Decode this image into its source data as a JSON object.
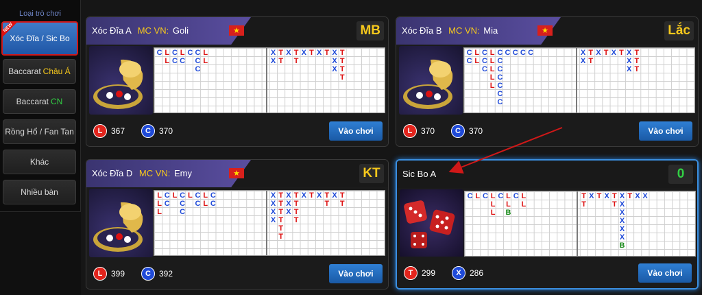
{
  "sidebar": {
    "title": "Loại trò chơi",
    "items": [
      {
        "label": "Xóc Đĩa / Sic Bo",
        "suffix": "",
        "active": true,
        "new_tag": "NEW"
      },
      {
        "label": "Baccarat",
        "suffix": "Châu Á",
        "suffix_color": "yellow"
      },
      {
        "label": "Baccarat",
        "suffix": "CN",
        "suffix_color": "green"
      },
      {
        "label": "Rồng Hổ / Fan Tan",
        "suffix": ""
      },
      {
        "label": "Khác",
        "suffix": ""
      },
      {
        "label": "Nhiều bàn",
        "suffix": ""
      }
    ]
  },
  "tables": [
    {
      "name": "Xóc Đĩa A",
      "mc_label": "MC VN:",
      "mc_name": "Goli",
      "badge": "MB",
      "stat1": {
        "icon": "L",
        "value": "367"
      },
      "stat2": {
        "icon": "C",
        "value": "370"
      },
      "button": "Vào chơi"
    },
    {
      "name": "Xóc Đĩa B",
      "mc_label": "MC VN:",
      "mc_name": "Mia",
      "badge": "Lắc",
      "stat1": {
        "icon": "L",
        "value": "370"
      },
      "stat2": {
        "icon": "C",
        "value": "370"
      },
      "button": "Vào chơi"
    },
    {
      "name": "Xóc Đĩa D",
      "mc_label": "MC VN:",
      "mc_name": "Emy",
      "badge": "KT",
      "stat1": {
        "icon": "L",
        "value": "399"
      },
      "stat2": {
        "icon": "C",
        "value": "392"
      },
      "button": "Vào chơi"
    },
    {
      "name": "Sic Bo A",
      "badge": "0",
      "stat1": {
        "icon": "T",
        "value": "299"
      },
      "stat2": {
        "icon": "X",
        "value": "286"
      },
      "button": "Vào chơi"
    }
  ],
  "colors": {
    "accent_blue": "#1f5aa6",
    "badge_yellow": "#f6c81c",
    "badge_green": "#32d044",
    "red_dot": "#e2241c",
    "blue_dot": "#1f4ad8",
    "road_red": "#d11",
    "road_blue": "#1f4ad8",
    "road_green": "#1a8a1a"
  },
  "roads": [
    {
      "left": [
        [
          "C"
        ],
        [
          "L",
          "L"
        ],
        [
          "C",
          "C"
        ],
        [
          "L",
          "C"
        ],
        [
          "C"
        ],
        [
          "C",
          "C",
          "C"
        ],
        [
          "L",
          "L"
        ]
      ],
      "right": [
        [
          "X",
          "X"
        ],
        [
          "T",
          "T"
        ],
        [
          "X"
        ],
        [
          "T",
          "T"
        ],
        [
          "X"
        ],
        [
          "T"
        ],
        [
          "X"
        ],
        [
          "T"
        ],
        [
          "X",
          "X",
          "X"
        ],
        [
          "T",
          "T",
          "T",
          "T"
        ]
      ]
    },
    {
      "left": [
        [
          "C",
          "C"
        ],
        [
          "L",
          "L"
        ],
        [
          "C",
          "C",
          "C"
        ],
        [
          "L",
          "L",
          "L",
          "L",
          "L"
        ],
        [
          "C",
          "C",
          "C",
          "C",
          "C",
          "C",
          "C"
        ],
        [
          "C"
        ],
        [
          "C"
        ],
        [
          "C"
        ],
        [
          "C"
        ]
      ],
      "right": [
        [
          "X",
          "X"
        ],
        [
          "T",
          "T"
        ],
        [
          "X"
        ],
        [
          "T"
        ],
        [
          "X"
        ],
        [
          "T"
        ],
        [
          "X",
          "X",
          "X"
        ],
        [
          "T",
          "T",
          "T"
        ]
      ]
    },
    {
      "left": [
        [
          "L",
          "L",
          "L"
        ],
        [
          "C",
          "C"
        ],
        [
          "L"
        ],
        [
          "C",
          "C",
          "C"
        ],
        [
          "L"
        ],
        [
          "C",
          "C"
        ],
        [
          "L",
          "L"
        ],
        [
          "C",
          "C"
        ]
      ],
      "right": [
        [
          "X",
          "X",
          "X",
          "X"
        ],
        [
          "T",
          "T",
          "T",
          "T",
          "T",
          "T"
        ],
        [
          "X",
          "X",
          "X"
        ],
        [
          "T",
          "T",
          "T",
          "T"
        ],
        [
          "X"
        ],
        [
          "T"
        ],
        [
          "X"
        ],
        [
          "T",
          "T"
        ],
        [
          "X"
        ],
        [
          "T",
          "T"
        ]
      ]
    },
    {
      "left": [
        [
          "C"
        ],
        [
          "L"
        ],
        [
          "C"
        ],
        [
          "L",
          "L",
          "L"
        ],
        [
          "C"
        ],
        [
          "L",
          "L",
          "B"
        ],
        [
          "C"
        ],
        [
          "L",
          "L"
        ]
      ],
      "right": [
        [
          "T",
          "T"
        ],
        [
          "X"
        ],
        [
          "T"
        ],
        [
          "X"
        ],
        [
          "T",
          "T"
        ],
        [
          "X",
          "X",
          "X",
          "X",
          "X",
          "X",
          "B"
        ],
        [
          "T"
        ],
        [
          "X"
        ],
        [
          "X"
        ]
      ]
    }
  ]
}
